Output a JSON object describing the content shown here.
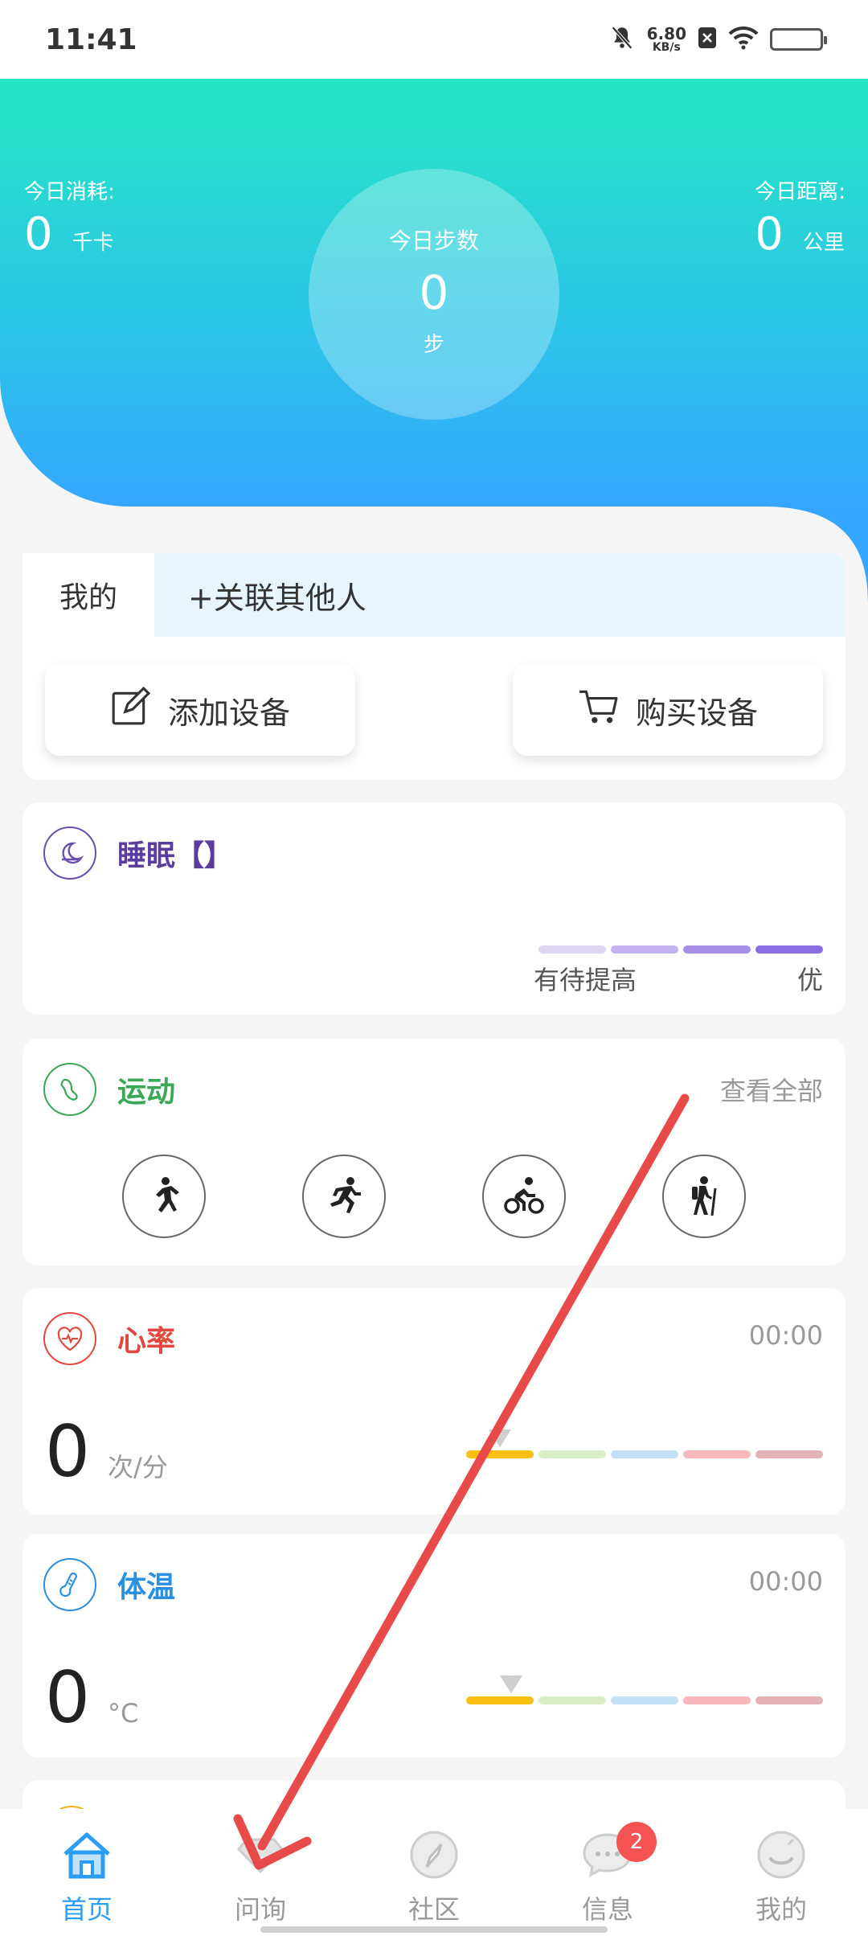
{
  "status_bar": {
    "time": "11:41",
    "net_speed_value": "6.80",
    "net_speed_unit": "KB/s"
  },
  "hero": {
    "left": {
      "label": "今日消耗:",
      "value": "0",
      "unit": "千卡"
    },
    "center": {
      "label": "今日步数",
      "value": "0",
      "unit": "步"
    },
    "right": {
      "label": "今日距离:",
      "value": "0",
      "unit": "公里"
    }
  },
  "devices": {
    "tab_mine": "我的",
    "tab_link": "+关联其他人",
    "add_device": "添加设备",
    "buy_device": "购买设备"
  },
  "sleep": {
    "title": "睡眠【】",
    "scale_low": "有待提高",
    "scale_high": "优",
    "color": "#5b3d9e"
  },
  "sport": {
    "title": "运动",
    "view_all": "查看全部",
    "color": "#3aa856"
  },
  "heart": {
    "title": "心率",
    "time": "00:00",
    "value": "0",
    "unit": "次/分",
    "color": "#e2483d"
  },
  "temperature": {
    "title": "体温",
    "time": "00:00",
    "value": "0",
    "unit": "°C",
    "color": "#2a8fe0"
  },
  "bottom_nav": {
    "items": [
      {
        "label": "首页",
        "icon": "home-icon",
        "active": true
      },
      {
        "label": "问询",
        "icon": "consult-icon",
        "active": false
      },
      {
        "label": "社区",
        "icon": "compass-icon",
        "active": false
      },
      {
        "label": "信息",
        "icon": "message-icon",
        "active": false,
        "badge": "2"
      },
      {
        "label": "我的",
        "icon": "profile-icon",
        "active": false
      }
    ]
  }
}
